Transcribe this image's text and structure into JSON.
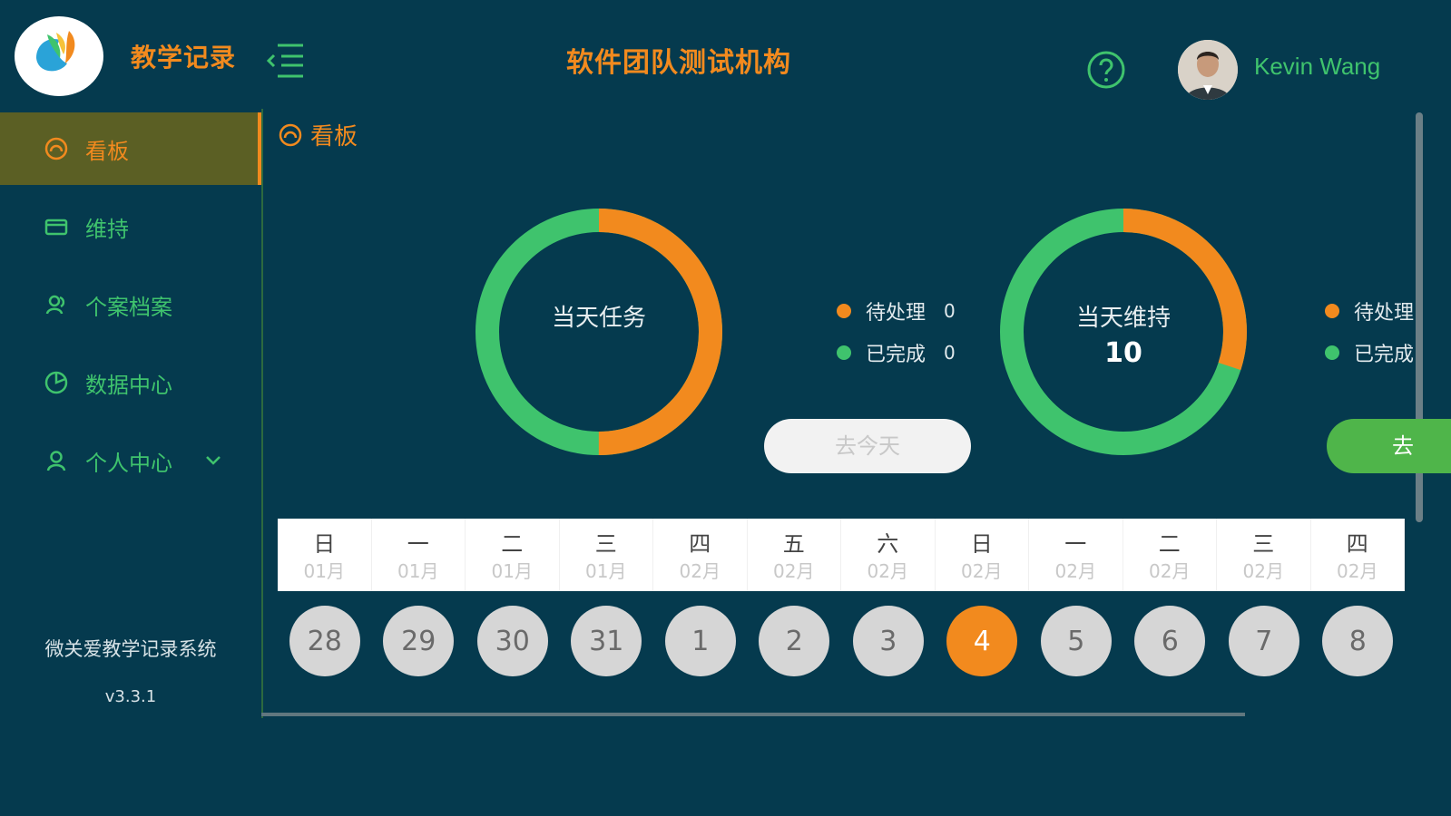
{
  "app": {
    "name": "教学记录",
    "org_title": "软件团队测试机构"
  },
  "user": {
    "name": "Kevin Wang"
  },
  "sidebar": {
    "items": [
      {
        "label": "看板",
        "icon": "dashboard-icon",
        "active": true
      },
      {
        "label": "维持",
        "icon": "card-icon",
        "active": false
      },
      {
        "label": "个案档案",
        "icon": "people-icon",
        "active": false
      },
      {
        "label": "数据中心",
        "icon": "pie-chart-icon",
        "active": false
      },
      {
        "label": "个人中心",
        "icon": "user-icon",
        "active": false,
        "has_submenu": true
      }
    ],
    "footer": {
      "system_name": "微关爱教学记录系统",
      "version": "v3.3.1"
    }
  },
  "breadcrumb": {
    "label": "看板"
  },
  "stats": [
    {
      "title": "当天任务",
      "value": "",
      "pending_fraction": 0.5,
      "legend": [
        {
          "label": "待处理",
          "count": "0",
          "color": "#f28a1e"
        },
        {
          "label": "已完成",
          "count": "0",
          "color": "#3fc36d"
        }
      ],
      "button": "去今天"
    },
    {
      "title": "当天维持",
      "value": "10",
      "pending_fraction": 0.3,
      "legend": [
        {
          "label": "待处理",
          "count": "",
          "color": "#f28a1e"
        },
        {
          "label": "已完成",
          "count": "",
          "color": "#3fc36d"
        }
      ],
      "button": "去"
    }
  ],
  "calendar": {
    "weekdays": [
      "日",
      "一",
      "二",
      "三",
      "四",
      "五",
      "六",
      "日",
      "一",
      "二",
      "三",
      "四"
    ],
    "months": [
      "01月",
      "01月",
      "01月",
      "01月",
      "02月",
      "02月",
      "02月",
      "02月",
      "02月",
      "02月",
      "02月",
      "02月"
    ],
    "days": [
      "28",
      "29",
      "30",
      "31",
      "1",
      "2",
      "3",
      "4",
      "5",
      "6",
      "7",
      "8"
    ],
    "selected_index": 7
  },
  "colors": {
    "accent": "#f28a1e",
    "green": "#3fc36d",
    "background": "#053a4e"
  }
}
